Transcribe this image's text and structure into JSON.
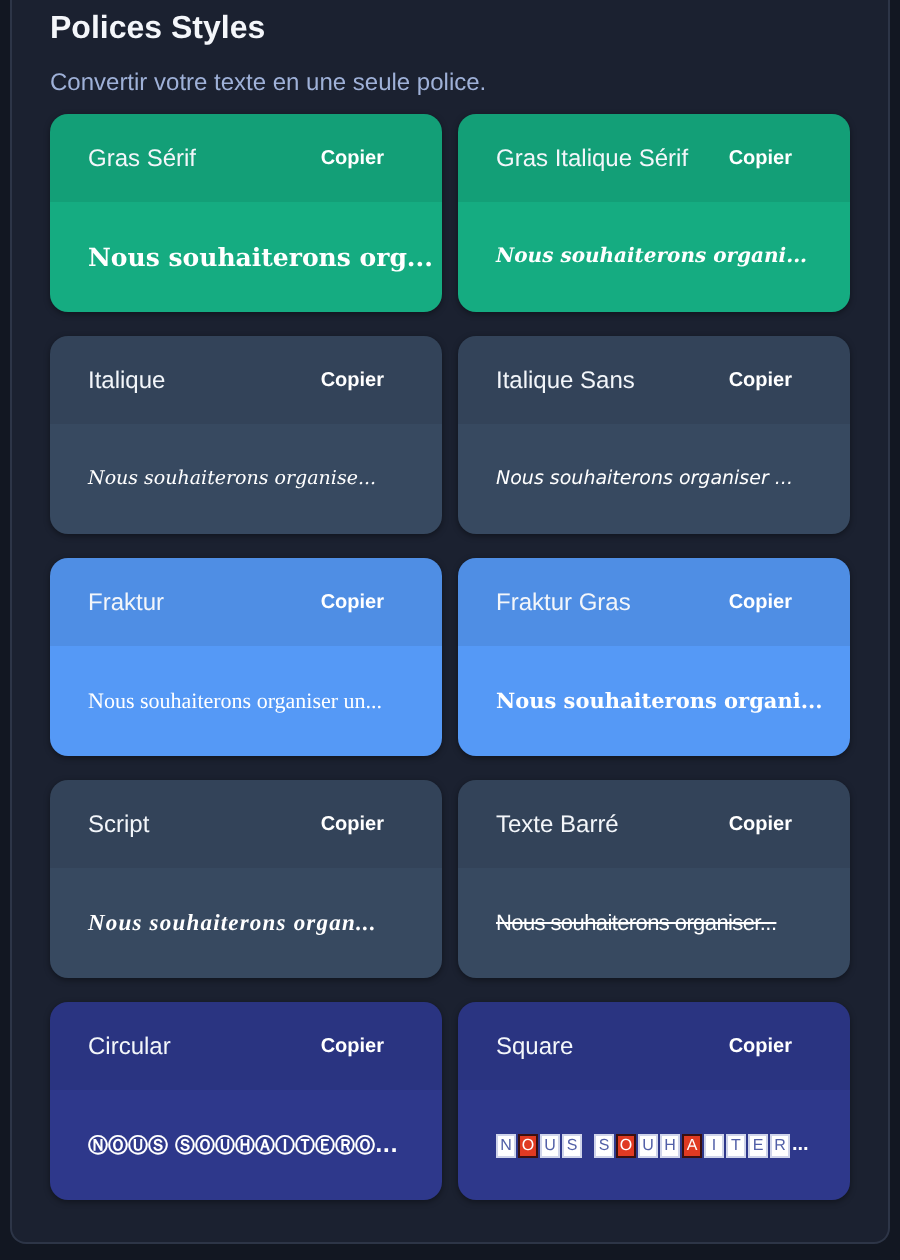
{
  "title": "Polices Styles",
  "subtitle": "Convertir votre texte en une seule police.",
  "cards": [
    {
      "name": "Gras Sérif",
      "button": "Copier",
      "color": "#15ac81",
      "kind": "bold-serif",
      "sample": "Nous souhaiterons org..."
    },
    {
      "name": "Gras Italique Sérif",
      "button": "Copier",
      "color": "#15ac81",
      "kind": "bold-italic-serif",
      "sample": "Nous souhaiterons organi..."
    },
    {
      "name": "Italique",
      "button": "Copier",
      "color": "#374960",
      "kind": "italic-serif",
      "sample": "Nous souhaiterons organise..."
    },
    {
      "name": "Italique Sans",
      "button": "Copier",
      "color": "#374960",
      "kind": "italic-sans",
      "sample": "Nous souhaiterons organiser ..."
    },
    {
      "name": "Fraktur",
      "button": "Copier",
      "color": "#5599f6",
      "kind": "fraktur",
      "sample": "Nous souhaiterons organiser un..."
    },
    {
      "name": "Fraktur Gras",
      "button": "Copier",
      "color": "#5599f6",
      "kind": "bold-fraktur",
      "sample": "Nous souhaiterons organi..."
    },
    {
      "name": "Script",
      "button": "Copier",
      "color": "#374960",
      "kind": "script",
      "sample": "Nous souhaiterons organ..."
    },
    {
      "name": "Texte Barré",
      "button": "Copier",
      "color": "#374960",
      "kind": "strike",
      "sample": "Nous souhaiterons organiser..."
    },
    {
      "name": "Circular",
      "button": "Copier",
      "color": "#2e388b",
      "kind": "circle",
      "sample": "ⓃⓄⓊⓈ ⓈⓄⓊⒽⒶⒾⓉⒺⓇⓄ..."
    },
    {
      "name": "Square",
      "button": "Copier",
      "color": "#2e388b",
      "kind": "square",
      "ellipsis": "...",
      "words": [
        [
          {
            "char": "N",
            "inverted": false
          },
          {
            "char": "O",
            "inverted": true
          },
          {
            "char": "U",
            "inverted": false
          },
          {
            "char": "S",
            "inverted": false
          }
        ],
        [
          {
            "char": "S",
            "inverted": false
          },
          {
            "char": "O",
            "inverted": true
          },
          {
            "char": "U",
            "inverted": false
          },
          {
            "char": "H",
            "inverted": false
          },
          {
            "char": "A",
            "inverted": true
          },
          {
            "char": "I",
            "inverted": false
          },
          {
            "char": "T",
            "inverted": false
          },
          {
            "char": "E",
            "inverted": false
          },
          {
            "char": "R",
            "inverted": false
          }
        ]
      ]
    }
  ]
}
